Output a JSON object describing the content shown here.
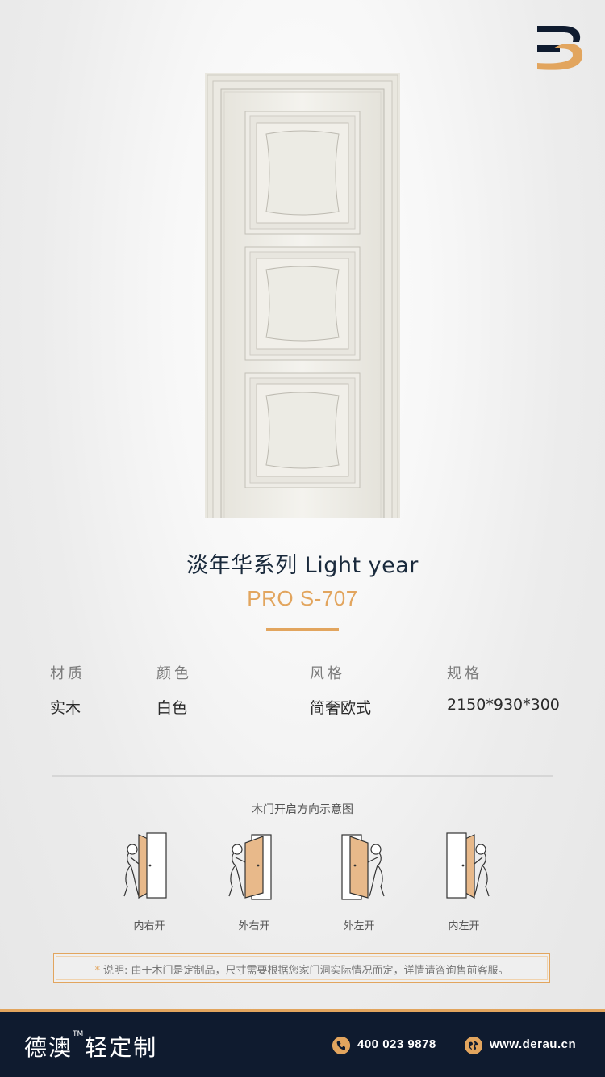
{
  "colors": {
    "accent": "#e2a55e",
    "navy": "#0f1b2f",
    "title": "#1a2a3c"
  },
  "product": {
    "series": "淡年华系列  Light year",
    "model": "PRO S-707"
  },
  "specs": [
    {
      "label": "材质",
      "value": "实木"
    },
    {
      "label": "颜色",
      "value": "白色"
    },
    {
      "label": "风格",
      "value": "简奢欧式"
    },
    {
      "label": "规格",
      "value": "2150*930*300"
    }
  ],
  "diagram": {
    "title": "木门开启方向示意图",
    "items": [
      {
        "label": "内右开"
      },
      {
        "label": "外右开"
      },
      {
        "label": "外左开"
      },
      {
        "label": "内左开"
      }
    ]
  },
  "note": {
    "star": "*",
    "text": "说明: 由于木门是定制品，尺寸需要根据您家门洞实际情况而定，详情请咨询售前客服。"
  },
  "footer": {
    "brand": "德澳",
    "tm": "TM",
    "slogan": "轻定制",
    "phone": "400 023 9878",
    "website": "www.derau.cn",
    "phone_icon": "phone-icon",
    "web_icon": "globe-icon"
  }
}
